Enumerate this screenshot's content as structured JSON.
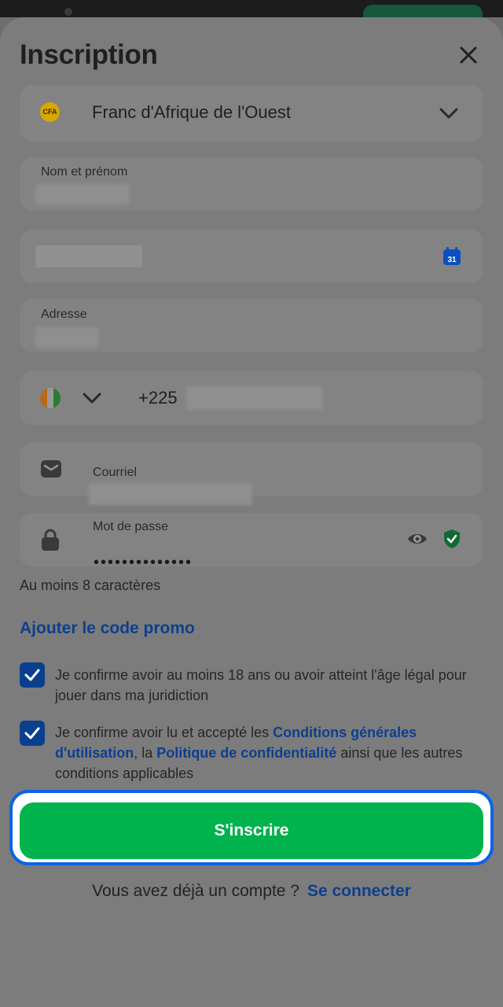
{
  "header": {
    "title": "Inscription"
  },
  "currency": {
    "badge": "CFA",
    "value": "Franc d'Afrique de l'Ouest"
  },
  "name_field": {
    "label": "Nom et prénom"
  },
  "date_field": {
    "calendar_day": "31"
  },
  "address_field": {
    "label": "Adresse"
  },
  "phone_field": {
    "dial_code": "+225"
  },
  "email_field": {
    "label": "Courriel"
  },
  "password_field": {
    "label": "Mot de passe",
    "masked_value": "••••••••••••••",
    "hint": "Au moins 8 caractères"
  },
  "promo": {
    "label": "Ajouter le code promo"
  },
  "consent_age": {
    "text": "Je confirme avoir au moins 18 ans ou avoir atteint l'âge légal pour jouer dans ma juridiction"
  },
  "consent_terms": {
    "prefix": "Je confirme avoir lu et accepté les ",
    "terms_link": "Conditions générales d'utilisation",
    "middle": ", la ",
    "privacy_link": "Politique de confidentialité",
    "suffix": " ainsi que les autres conditions applicables"
  },
  "submit": {
    "label": "S'inscrire"
  },
  "footer": {
    "question": "Vous avez déjà un compte ?",
    "login_link": "Se connecter"
  },
  "colors": {
    "accent_green": "#00b34d",
    "link_blue": "#0d3f8f",
    "focus_blue": "#0b63e6"
  }
}
